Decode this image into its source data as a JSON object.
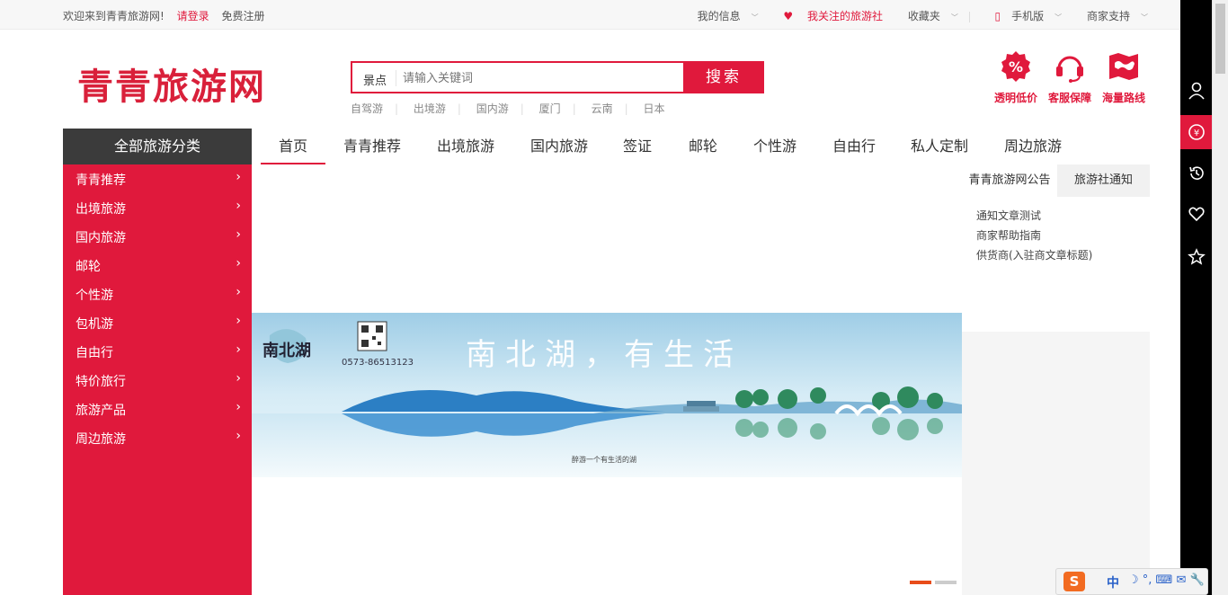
{
  "topbar": {
    "welcome": "欢迎来到青青旅游网!",
    "login": "请登录",
    "register": "免费注册",
    "my_info": "我的信息",
    "my_followed": "我关注的旅游社",
    "favorites": "收藏夹",
    "mobile": "手机版",
    "merchant": "商家支持"
  },
  "header": {
    "logo": "青青旅游网",
    "search_scope": "景点",
    "search_placeholder": "请输入关键词",
    "search_button": "搜索",
    "hotwords": [
      "自驾游",
      "出境游",
      "国内游",
      "厦门",
      "云南",
      "日本"
    ],
    "promos": [
      {
        "label": "透明低价",
        "icon": "percent-badge-icon"
      },
      {
        "label": "客服保障",
        "icon": "headset-icon"
      },
      {
        "label": "海量路线",
        "icon": "map-icon"
      }
    ]
  },
  "category": {
    "title": "全部旅游分类",
    "items": [
      "青青推荐",
      "出境旅游",
      "国内旅游",
      "邮轮",
      "个性游",
      "包机游",
      "自由行",
      "特价旅行",
      "旅游产品",
      "周边旅游"
    ]
  },
  "nav": {
    "items": [
      "首页",
      "青青推荐",
      "出境旅游",
      "国内旅游",
      "签证",
      "邮轮",
      "个性游",
      "自由行",
      "私人定制",
      "周边旅游"
    ],
    "active_index": 0
  },
  "banner": {
    "brand": "南北湖",
    "phone": "0573-86513123",
    "slogan": "南北湖，有生活",
    "caption": "醉游一个有生活的湖",
    "slides": 2,
    "active_slide": 1
  },
  "notice": {
    "tabs": [
      "青青旅游网公告",
      "旅游社通知"
    ],
    "items": [
      "通知文章测试",
      "商家帮助指南",
      "供货商(入驻商文章标题)"
    ]
  },
  "ime": {
    "lang": "中"
  },
  "colors": {
    "brand_red": "#e0193c",
    "dark": "#3b3b3b"
  }
}
